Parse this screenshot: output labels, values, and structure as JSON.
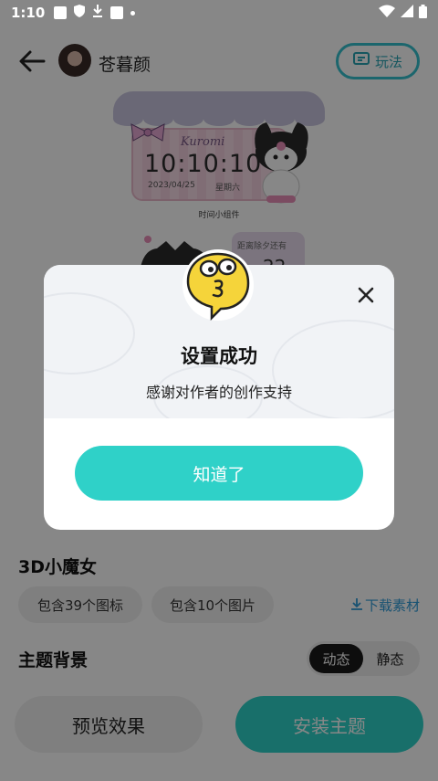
{
  "status_bar": {
    "time": "1:10"
  },
  "header": {
    "author_name": "苍暮颜",
    "play_button_label": "玩法"
  },
  "preview": {
    "clock_brand": "Kuromi",
    "clock_time": "10:10:10",
    "clock_date": "2023/04/25",
    "clock_weekday": "星期六",
    "widget_caption": "时间小组件",
    "widget2_label": "距离除夕还有",
    "widget2_value": "22"
  },
  "theme": {
    "name": "3D小魔女",
    "chips": [
      "包含39个图标",
      "包含10个图片"
    ],
    "download_label": "下载素材",
    "background_label": "主题背景",
    "bg_toggle": [
      "动态",
      "静态"
    ],
    "bg_selected": "动态",
    "preview_button": "预览效果",
    "install_button": "安装主题"
  },
  "dialog": {
    "title": "设置成功",
    "message": "感谢对作者的创作支持",
    "confirm_label": "知道了"
  },
  "colors": {
    "accent": "#2fd1c8",
    "link": "#2f9bd8",
    "outline_accent": "#35c0cf"
  }
}
